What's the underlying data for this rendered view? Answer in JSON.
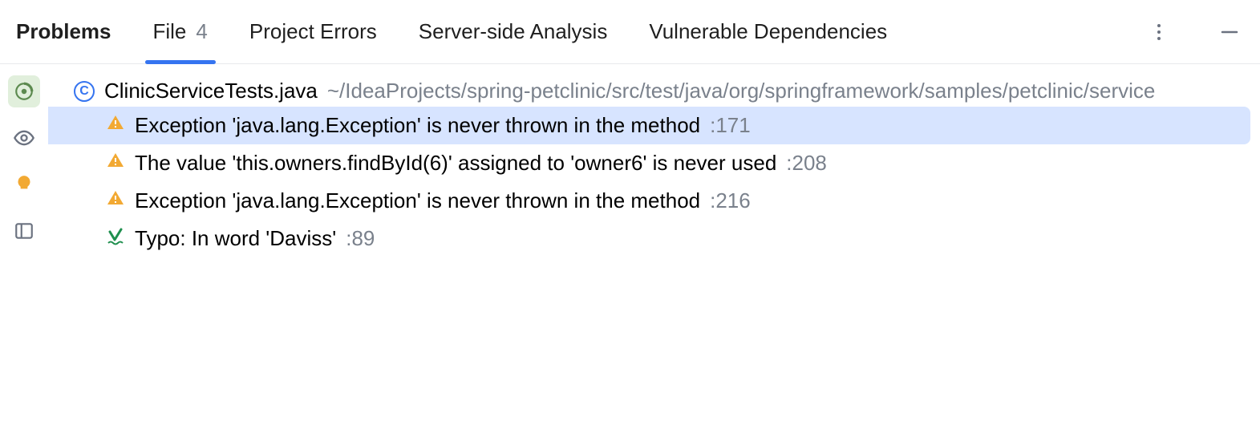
{
  "tabs": {
    "problems": "Problems",
    "file": {
      "label": "File",
      "count": "4"
    },
    "project_errors": "Project Errors",
    "server_side": "Server-side Analysis",
    "vulnerable": "Vulnerable Dependencies"
  },
  "file": {
    "badge_letter": "C",
    "name": "ClinicServiceTests.java",
    "path": "~/IdeaProjects/spring-petclinic/src/test/java/org/springframework/samples/petclinic/service"
  },
  "problems": [
    {
      "type": "warning",
      "text": "Exception 'java.lang.Exception' is never thrown in the method",
      "line": ":171",
      "selected": true
    },
    {
      "type": "warning",
      "text": "The value 'this.owners.findById(6)' assigned to 'owner6' is never used",
      "line": ":208",
      "selected": false
    },
    {
      "type": "warning",
      "text": "Exception 'java.lang.Exception' is never thrown in the method",
      "line": ":216",
      "selected": false
    },
    {
      "type": "typo",
      "text": "Typo: In word 'Daviss'",
      "line": ":89",
      "selected": false
    }
  ]
}
